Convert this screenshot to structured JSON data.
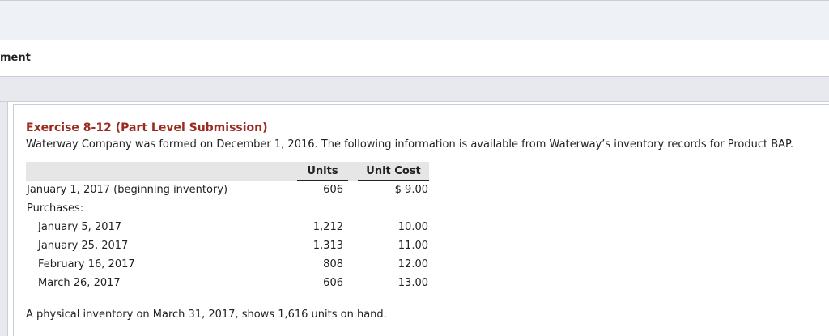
{
  "header": {
    "title": "ment"
  },
  "exercise": {
    "title": "Exercise 8-12 (Part Level Submission)",
    "intro": "Waterway Company was formed on December 1, 2016. The following information is available from Waterway’s inventory records for Product BAP.",
    "table": {
      "col_units": "Units",
      "col_cost": "Unit Cost",
      "beginning": {
        "label": "January 1, 2017 (beginning inventory)",
        "units": "606",
        "cost": "$ 9.00"
      },
      "purchases_label": "Purchases:",
      "purchases": [
        {
          "label": "January 5, 2017",
          "units": "1,212",
          "cost": "10.00"
        },
        {
          "label": "January 25, 2017",
          "units": "1,313",
          "cost": "11.00"
        },
        {
          "label": "February 16, 2017",
          "units": "808",
          "cost": "12.00"
        },
        {
          "label": "March 26, 2017",
          "units": "606",
          "cost": "13.00"
        }
      ]
    },
    "footer": "A physical inventory on March 31, 2017, shows 1,616 units on hand."
  }
}
